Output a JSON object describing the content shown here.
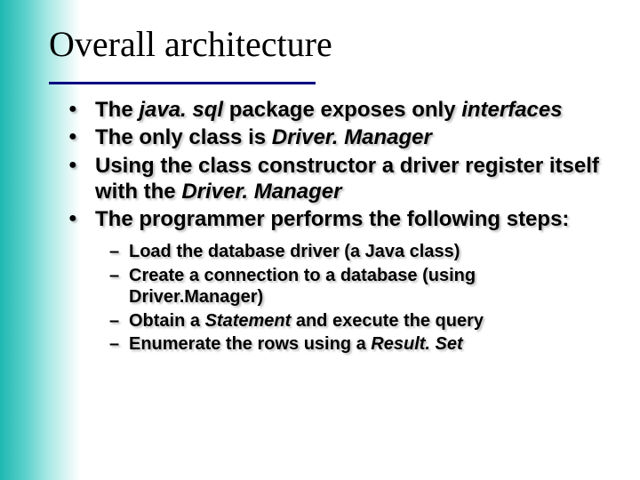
{
  "title": "Overall architecture",
  "bullets": {
    "b1a": "The ",
    "b1b": "java. sql",
    "b1c": " package exposes only ",
    "b1d": "interfaces",
    "b2a": "The only class is ",
    "b2b": "Driver. Manager",
    "b3a": "Using the class constructor a driver register itself with the ",
    "b3b": "Driver. Manager",
    "b4": "The programmer performs the following steps:"
  },
  "sub": {
    "s1": "Load the database driver (a Java class)",
    "s2": "Create a connection to a database (using Driver.Manager)",
    "s3a": "Obtain a ",
    "s3b": "Statement",
    "s3c": " and execute the query",
    "s4a": "Enumerate the rows using a ",
    "s4b": "Result. Set"
  }
}
